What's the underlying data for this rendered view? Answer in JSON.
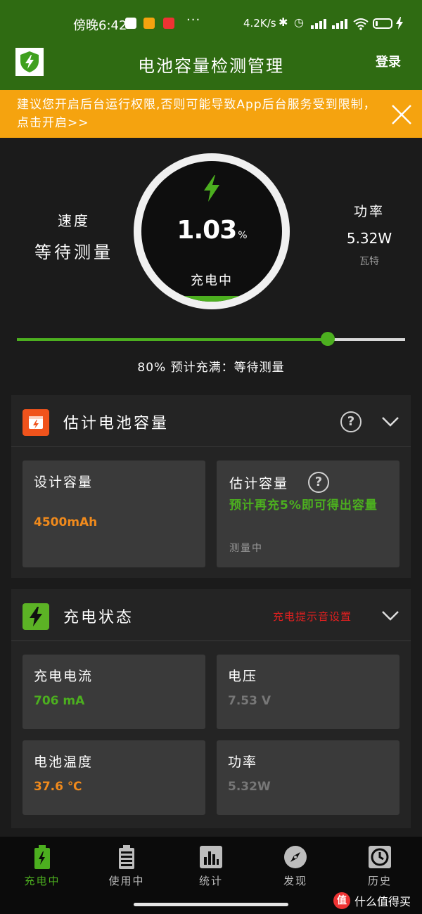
{
  "status_bar": {
    "time": "傍晚6:42",
    "dots": "···",
    "network_speed": "4.2K/s",
    "battery_level_fraction": 0.1
  },
  "app_bar": {
    "title": "电池容量检测管理",
    "login_label": "登录"
  },
  "banner": {
    "text": "建议您开启后台运行权限,否则可能导致App后台服务受到限制，点击开启>>"
  },
  "gauge": {
    "value": "1.03",
    "unit": "%",
    "status": "充电中",
    "fill_fraction": 0.0103
  },
  "speed": {
    "label": "速度",
    "value": "等待测量"
  },
  "power": {
    "label": "功率",
    "value": "5.32W",
    "unit": "瓦特"
  },
  "charge_limit": {
    "fraction": 0.8,
    "caption": "80%   预计充满：等待测量"
  },
  "capacity_section": {
    "title": "估计电池容量",
    "design": {
      "label": "设计容量",
      "value": "4500mAh"
    },
    "estimate": {
      "label": "估计容量",
      "hint": "预计再充5%即可得出容量",
      "status": "测量中"
    }
  },
  "charge_section": {
    "title": "充电状态",
    "sound_setting": "充电提示音设置",
    "current": {
      "label": "充电电流",
      "value": "706 mA"
    },
    "voltage": {
      "label": "电压",
      "value": "7.53 V"
    },
    "temperature": {
      "label": "电池温度",
      "value": "37.6 ℃"
    },
    "power": {
      "label": "功率",
      "value": "5.32W"
    }
  },
  "bottom_nav": {
    "items": [
      {
        "label": "充电中",
        "icon": "charging-battery-icon",
        "active": true
      },
      {
        "label": "使用中",
        "icon": "battery-icon",
        "active": false
      },
      {
        "label": "统计",
        "icon": "bar-chart-icon",
        "active": false
      },
      {
        "label": "发现",
        "icon": "compass-icon",
        "active": false
      },
      {
        "label": "历史",
        "icon": "clock-icon",
        "active": false
      }
    ]
  },
  "watermark": {
    "text": "什么值得买",
    "mark": "值"
  },
  "colors": {
    "app_bar": "#2f6b12",
    "banner": "#f5a30f",
    "accent_green": "#4caf1f",
    "accent_orange": "#f08a1c",
    "alert_red": "#e02020"
  }
}
